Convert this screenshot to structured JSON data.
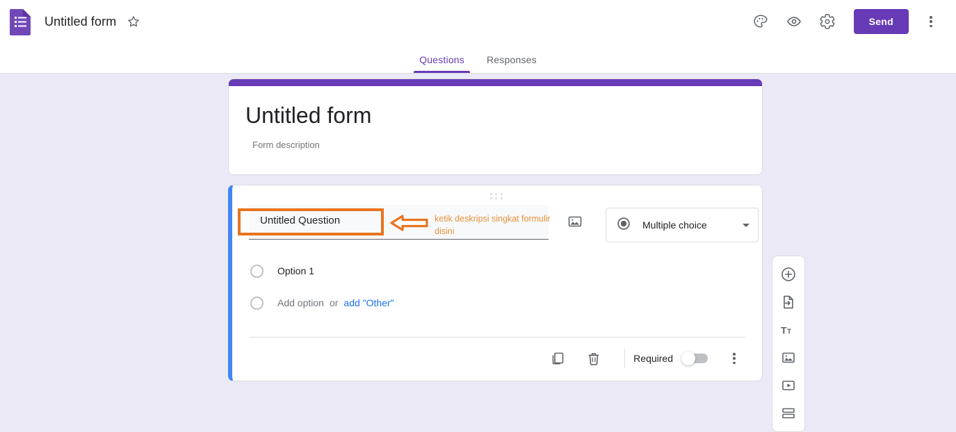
{
  "topbar": {
    "app_icon": "google-forms-icon",
    "doc_title": "Untitled form",
    "star_icon": "star-outline-icon",
    "theme_icon": "palette-icon",
    "preview_icon": "eye-icon",
    "settings_icon": "gear-icon",
    "send_label": "Send",
    "more_icon": "more-vertical-icon"
  },
  "tabs": [
    {
      "label": "Questions",
      "active": true
    },
    {
      "label": "Responses",
      "active": false
    }
  ],
  "form_header": {
    "title": "Untitled form",
    "description_placeholder": "Form description",
    "description_value": ""
  },
  "annotation": {
    "text": "ketik deskripsi singkat formulir disini",
    "arrow_icon": "left-arrow-icon",
    "box_color": "#e8741f",
    "text_color": "#e8903a"
  },
  "question": {
    "drag_handle": "drag-handle-dots",
    "title_text": "Untitled Question",
    "image_icon": "insert-image-icon",
    "type": {
      "icon": "radio-button-icon",
      "label": "Multiple choice",
      "caret": "chevron-down-icon"
    },
    "options": [
      {
        "label": "Option 1",
        "muted": false
      }
    ],
    "add_option_label": "Add option",
    "or_label": "or",
    "add_other_label": "add \"Other\"",
    "actions": {
      "duplicate_icon": "duplicate-icon",
      "delete_icon": "trash-icon",
      "required_label": "Required",
      "required_on": false,
      "more_icon": "more-vertical-icon"
    }
  },
  "side_toolbar": [
    {
      "name": "add-question",
      "icon": "plus-circle-icon"
    },
    {
      "name": "import-questions",
      "icon": "import-file-icon"
    },
    {
      "name": "add-title-description",
      "icon": "title-text-icon"
    },
    {
      "name": "add-image",
      "icon": "image-icon"
    },
    {
      "name": "add-video",
      "icon": "video-icon"
    },
    {
      "name": "add-section",
      "icon": "section-icon"
    }
  ],
  "colors": {
    "brand_purple": "#673ab7",
    "page_background": "#ece9f6",
    "active_question_bar": "#4285f4",
    "link_blue": "#1a73e8",
    "annotation_orange": "#e8741f"
  }
}
